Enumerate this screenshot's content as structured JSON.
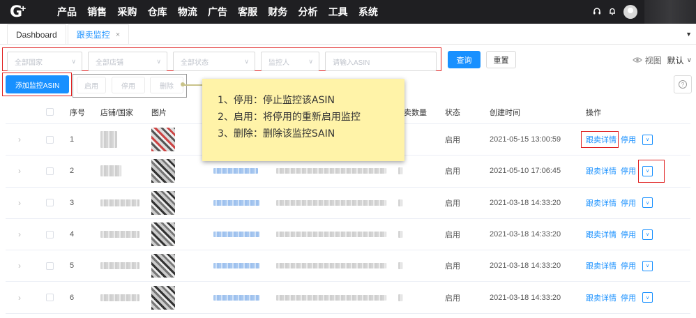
{
  "nav": {
    "logo": "G",
    "logo_plus": "+",
    "menu": [
      "产品",
      "销售",
      "采购",
      "仓库",
      "物流",
      "广告",
      "客服",
      "财务",
      "分析",
      "工具",
      "系统"
    ],
    "icons": [
      "headset-icon",
      "bell-icon",
      "avatar"
    ]
  },
  "tabs": [
    {
      "label": "Dashboard",
      "active": false
    },
    {
      "label": "跟卖监控",
      "active": true,
      "close": "×"
    }
  ],
  "filters": {
    "country": "全部国家",
    "shop": "全部店铺",
    "status": "全部状态",
    "monitor": "监控人",
    "asin_placeholder": "请输入ASIN",
    "query": "查询",
    "reset": "重置"
  },
  "view": {
    "label": "视图",
    "default": "默认"
  },
  "actions": {
    "add": "添加监控ASIN",
    "enable": "启用",
    "disable": "停用",
    "delete": "删除"
  },
  "table": {
    "headers": {
      "seq": "序号",
      "shop_country": "店铺/国家",
      "image": "图片",
      "sell_count": "跟卖数量",
      "status": "状态",
      "created": "创建时间",
      "ops": "操作"
    },
    "rows": [
      {
        "seq": "1",
        "status": "启用",
        "created": "2021-05-15 13:00:59",
        "detail": "跟卖详情",
        "disable": "停用"
      },
      {
        "seq": "2",
        "status": "启用",
        "created": "2021-05-10 17:06:45",
        "detail": "跟卖详情",
        "disable": "停用"
      },
      {
        "seq": "3",
        "status": "启用",
        "created": "2021-03-18 14:33:20",
        "detail": "跟卖详情",
        "disable": "停用"
      },
      {
        "seq": "4",
        "status": "启用",
        "created": "2021-03-18 14:33:20",
        "detail": "跟卖详情",
        "disable": "停用"
      },
      {
        "seq": "5",
        "status": "启用",
        "created": "2021-03-18 14:33:20",
        "detail": "跟卖详情",
        "disable": "停用"
      },
      {
        "seq": "6",
        "status": "启用",
        "created": "2021-03-18 14:33:20",
        "detail": "跟卖详情",
        "disable": "停用"
      }
    ]
  },
  "tooltip": {
    "line1": "1、停用：停止监控该ASIN",
    "line2": "2、启用：将停用的重新启用监控",
    "line3": "3、删除：删除该监控SAIN"
  },
  "colors": {
    "primary": "#1890ff",
    "highlight": "#e02020",
    "note_bg": "#fff3a8",
    "nav_bg": "#1f1f22"
  }
}
